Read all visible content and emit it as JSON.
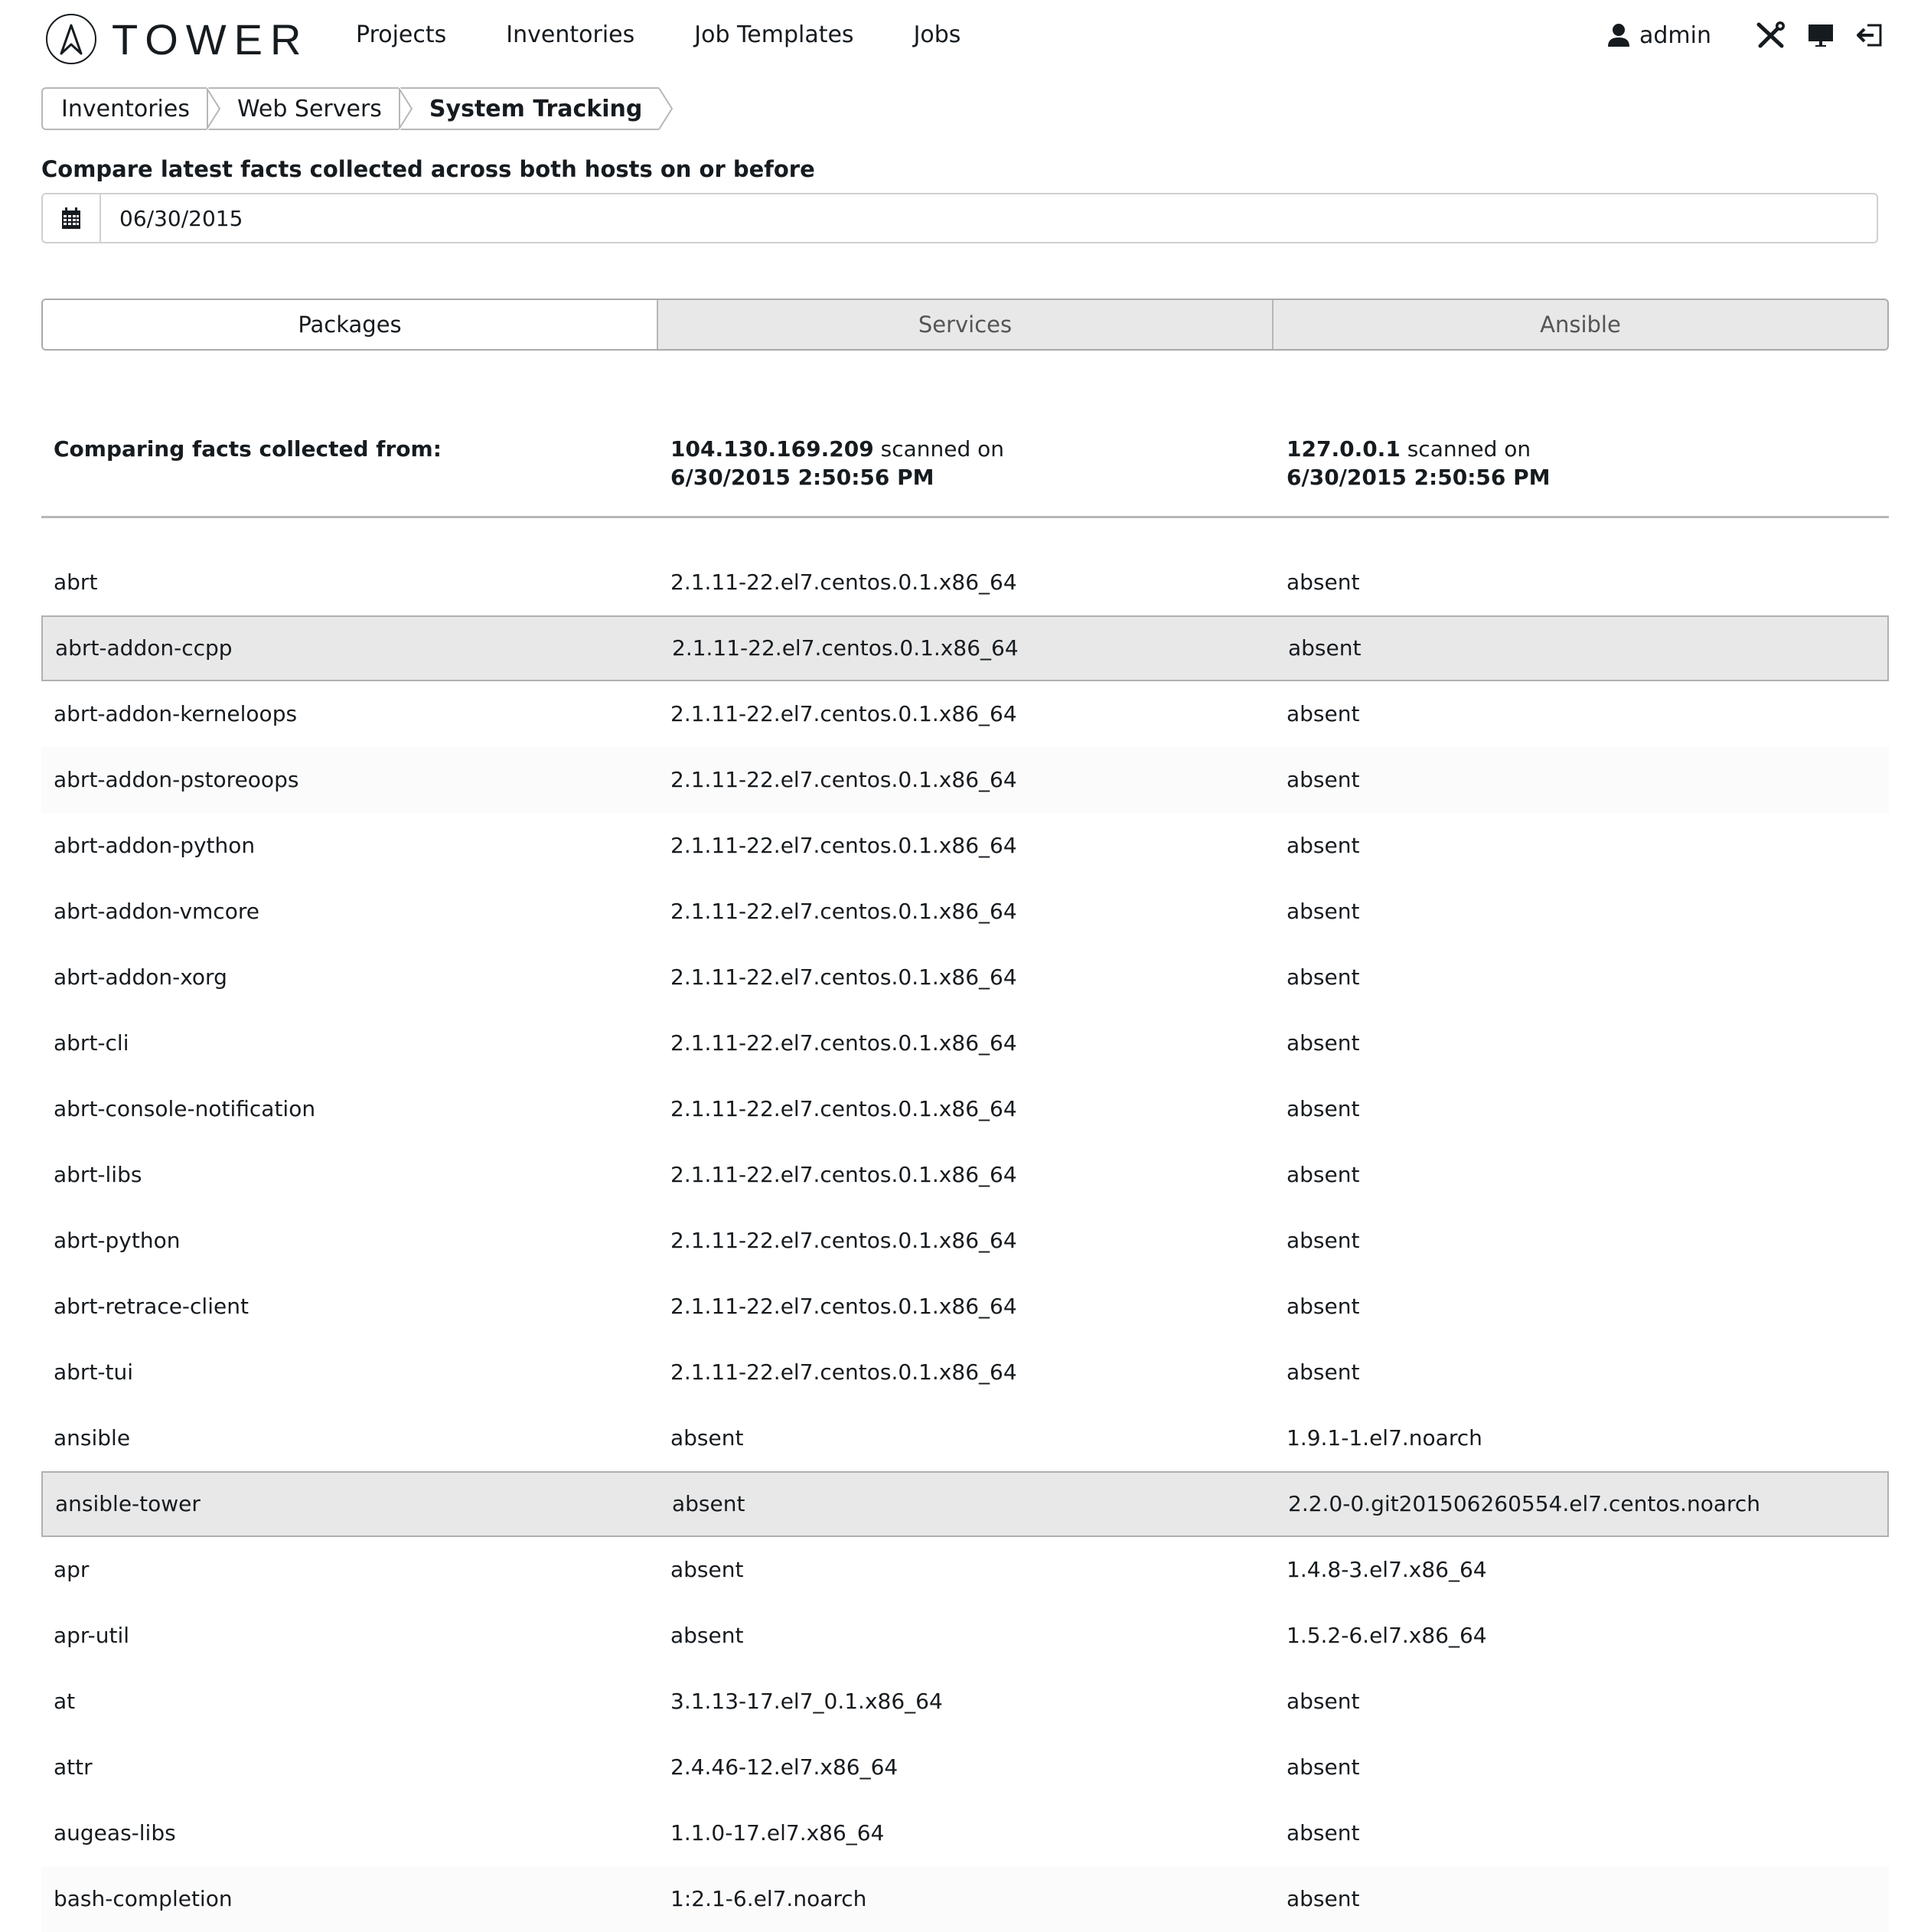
{
  "app": {
    "logo_text": "TOWER",
    "nav": [
      "Projects",
      "Inventories",
      "Job Templates",
      "Jobs"
    ],
    "user": "admin"
  },
  "breadcrumb": [
    "Inventories",
    "Web Servers",
    "System Tracking"
  ],
  "compare_label": "Compare latest facts collected across both hosts on or before",
  "date_value": "06/30/2015",
  "tabs": [
    {
      "label": "Packages",
      "active": true
    },
    {
      "label": "Services",
      "active": false
    },
    {
      "label": "Ansible",
      "active": false
    }
  ],
  "facts_header": {
    "title": "Comparing facts collected from:",
    "host1": {
      "name": "104.130.169.209",
      "scanned_on_label": "scanned on",
      "timestamp": "6/30/2015 2:50:56 PM"
    },
    "host2": {
      "name": "127.0.0.1",
      "scanned_on_label": "scanned on",
      "timestamp": "6/30/2015 2:50:56 PM"
    }
  },
  "rows": [
    {
      "name": "abrt",
      "host1": "2.1.11-22.el7.centos.0.1.x86_64",
      "host2": "absent",
      "style": ""
    },
    {
      "name": "abrt-addon-ccpp",
      "host1": "2.1.11-22.el7.centos.0.1.x86_64",
      "host2": "absent",
      "style": "highlight"
    },
    {
      "name": "abrt-addon-kerneloops",
      "host1": "2.1.11-22.el7.centos.0.1.x86_64",
      "host2": "absent",
      "style": ""
    },
    {
      "name": "abrt-addon-pstoreoops",
      "host1": "2.1.11-22.el7.centos.0.1.x86_64",
      "host2": "absent",
      "style": "striped"
    },
    {
      "name": "abrt-addon-python",
      "host1": "2.1.11-22.el7.centos.0.1.x86_64",
      "host2": "absent",
      "style": ""
    },
    {
      "name": "abrt-addon-vmcore",
      "host1": "2.1.11-22.el7.centos.0.1.x86_64",
      "host2": "absent",
      "style": ""
    },
    {
      "name": "abrt-addon-xorg",
      "host1": "2.1.11-22.el7.centos.0.1.x86_64",
      "host2": "absent",
      "style": ""
    },
    {
      "name": "abrt-cli",
      "host1": "2.1.11-22.el7.centos.0.1.x86_64",
      "host2": "absent",
      "style": ""
    },
    {
      "name": "abrt-console-notification",
      "host1": "2.1.11-22.el7.centos.0.1.x86_64",
      "host2": "absent",
      "style": ""
    },
    {
      "name": "abrt-libs",
      "host1": "2.1.11-22.el7.centos.0.1.x86_64",
      "host2": "absent",
      "style": ""
    },
    {
      "name": "abrt-python",
      "host1": "2.1.11-22.el7.centos.0.1.x86_64",
      "host2": "absent",
      "style": ""
    },
    {
      "name": "abrt-retrace-client",
      "host1": "2.1.11-22.el7.centos.0.1.x86_64",
      "host2": "absent",
      "style": ""
    },
    {
      "name": "abrt-tui",
      "host1": "2.1.11-22.el7.centos.0.1.x86_64",
      "host2": "absent",
      "style": ""
    },
    {
      "name": "ansible",
      "host1": "absent",
      "host2": "1.9.1-1.el7.noarch",
      "style": ""
    },
    {
      "name": "ansible-tower",
      "host1": "absent",
      "host2": "2.2.0-0.git201506260554.el7.centos.noarch",
      "style": "highlight"
    },
    {
      "name": "apr",
      "host1": "absent",
      "host2": "1.4.8-3.el7.x86_64",
      "style": ""
    },
    {
      "name": "apr-util",
      "host1": "absent",
      "host2": "1.5.2-6.el7.x86_64",
      "style": ""
    },
    {
      "name": "at",
      "host1": "3.1.13-17.el7_0.1.x86_64",
      "host2": "absent",
      "style": ""
    },
    {
      "name": "attr",
      "host1": "2.4.46-12.el7.x86_64",
      "host2": "absent",
      "style": ""
    },
    {
      "name": "augeas-libs",
      "host1": "1.1.0-17.el7.x86_64",
      "host2": "absent",
      "style": ""
    },
    {
      "name": "bash-completion",
      "host1": "1:2.1-6.el7.noarch",
      "host2": "absent",
      "style": "striped"
    }
  ]
}
